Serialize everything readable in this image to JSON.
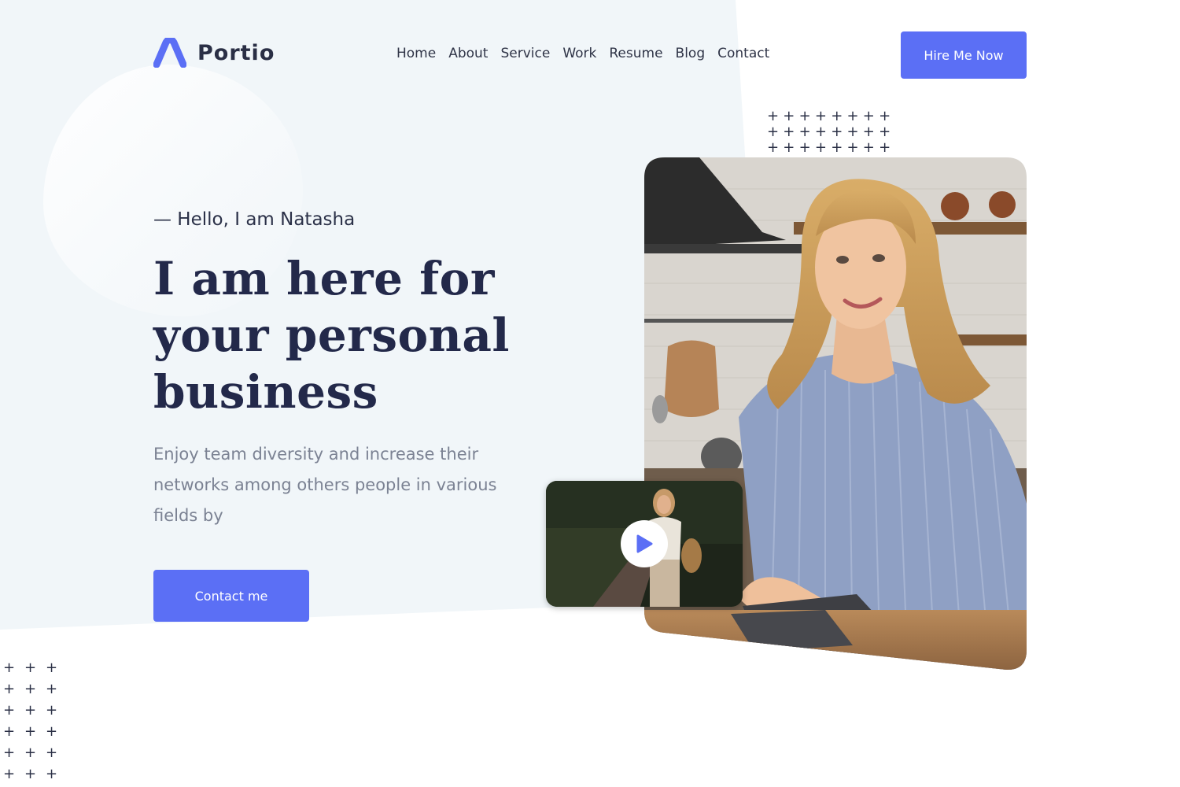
{
  "header": {
    "brand": "Portio",
    "nav": [
      "Home",
      "About",
      "Service",
      "Work",
      "Resume",
      "Blog",
      "Contact"
    ],
    "cta_label": "Hire Me Now"
  },
  "hero": {
    "eyebrow": "— Hello, I am Natasha",
    "headline_lines": [
      "I am here for",
      "your personal",
      "business"
    ],
    "description_lines": [
      "Enjoy team diversity and increase their",
      "networks among others people in various",
      "fields by"
    ],
    "cta_label": "Contact me"
  },
  "colors": {
    "accent": "#5b6ff5",
    "heading": "#23294a",
    "body_text": "#7b8293",
    "panel_bg": "#f1f6f9"
  },
  "icons": {
    "logo": "logo-mark-icon",
    "play": "play-icon",
    "decor": "plus-icon"
  }
}
